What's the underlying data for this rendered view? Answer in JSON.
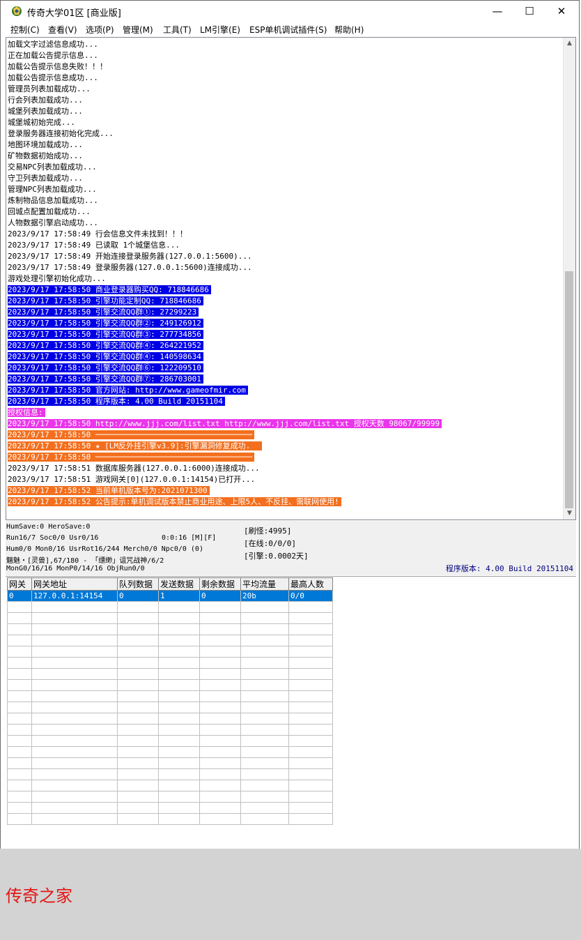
{
  "window": {
    "title": "传奇大学01区 [商业版]",
    "minimize": "—",
    "maximize": "☐",
    "close": "✕"
  },
  "menu": [
    "控制(C)",
    "查看(V)",
    "选项(P)",
    "管理(M)",
    "工具(T)",
    "LM引擎(E)",
    "ESP单机调试插件(S)",
    "帮助(H)"
  ],
  "log": [
    {
      "text": "加载文字过滤信息成功...",
      "style": ""
    },
    {
      "text": "正在加载公告提示信息...",
      "style": ""
    },
    {
      "text": "加载公告提示信息失败！！！",
      "style": ""
    },
    {
      "text": "加载公告提示信息成功...",
      "style": ""
    },
    {
      "text": "管理员列表加载成功...",
      "style": ""
    },
    {
      "text": "行会列表加载成功...",
      "style": ""
    },
    {
      "text": "城堡列表加载成功...",
      "style": ""
    },
    {
      "text": "城堡城初始完成...",
      "style": ""
    },
    {
      "text": "登录服务器连接初始化完成...",
      "style": ""
    },
    {
      "text": "地图环境加载成功...",
      "style": ""
    },
    {
      "text": "矿物数据初始成功...",
      "style": ""
    },
    {
      "text": "交易NPC列表加载成功...",
      "style": ""
    },
    {
      "text": "守卫列表加载成功...",
      "style": ""
    },
    {
      "text": "管理NPC列表加载成功...",
      "style": ""
    },
    {
      "text": "炼制物品信息加载成功...",
      "style": ""
    },
    {
      "text": "回城点配置加载成功...",
      "style": ""
    },
    {
      "text": "人物数据引擎启动成功...",
      "style": ""
    },
    {
      "text": "2023/9/17 17:58:49 行会信息文件未找到！！！",
      "style": ""
    },
    {
      "text": "2023/9/17 17:58:49 已读取 1个城堡信息...",
      "style": ""
    },
    {
      "text": "2023/9/17 17:58:49 开始连接登录服务器(127.0.0.1:5600)...",
      "style": ""
    },
    {
      "text": "2023/9/17 17:58:49 登录服务器(127.0.0.1:5600)连接成功...",
      "style": ""
    },
    {
      "text": "游戏处理引擎初始化成功...",
      "style": ""
    },
    {
      "text": "2023/9/17 17:58:50 商业登录器购买QQ: 718846686",
      "style": "hl-blue"
    },
    {
      "text": "2023/9/17 17:58:50 引擎功能定制QQ: 718846686",
      "style": "hl-blue"
    },
    {
      "text": "2023/9/17 17:58:50 引擎交流QQ群①: 27299223",
      "style": "hl-blue"
    },
    {
      "text": "2023/9/17 17:58:50 引擎交流QQ群②: 249126912",
      "style": "hl-blue"
    },
    {
      "text": "2023/9/17 17:58:50 引擎交流QQ群③: 277734856",
      "style": "hl-blue"
    },
    {
      "text": "2023/9/17 17:58:50 引擎交流QQ群④: 264221952",
      "style": "hl-blue"
    },
    {
      "text": "2023/9/17 17:58:50 引擎交流QQ群④: 140598634",
      "style": "hl-blue"
    },
    {
      "text": "2023/9/17 17:58:50 引擎交流QQ群⑥: 122209510",
      "style": "hl-blue"
    },
    {
      "text": "2023/9/17 17:58:50 引擎交流QQ群⑦: 286703001",
      "style": "hl-blue"
    },
    {
      "text": "2023/9/17 17:58:50 官方网站: http://www.gameofmir.com",
      "style": "hl-blue"
    },
    {
      "text": "2023/9/17 17:58:50 程序版本: 4.00 Build 20151104",
      "style": "hl-blue"
    },
    {
      "text": "授权信息:",
      "style": "hl-magenta"
    },
    {
      "text": "2023/9/17 17:58:50 http://www.jjj.com/list.txt http://www.jjj.com/list.txt 授权天数 98067/99999",
      "style": "hl-magenta"
    },
    {
      "text": "2023/9/17 17:58:50 ──────────────────────────────────",
      "style": "hl-orange"
    },
    {
      "text": "2023/9/17 17:58:50 ★ [LM反外挂引擎v3.9]:引擎漏洞修复成功.  ",
      "style": "hl-orange"
    },
    {
      "text": "2023/9/17 17:58:50 ──────────────────────────────────",
      "style": "hl-orange"
    },
    {
      "text": "2023/9/17 17:58:51 数据库服务器(127.0.0.1:6000)连接成功...",
      "style": ""
    },
    {
      "text": "2023/9/17 17:58:51 游戏网关[0](127.0.0.1:14154)已打开...",
      "style": ""
    },
    {
      "text": "2023/9/17 17:58:52 当前单机版本号为:2021071300",
      "style": "hl-orange"
    },
    {
      "text": "2023/9/17 17:58:52 公告提示:单机调试版本禁止商业用途、上限5人、不反挂、需联网使用!",
      "style": "hl-orange"
    }
  ],
  "status": {
    "line1": "HumSave:0 HeroSave:0",
    "line2": "Run16/7 Soc0/0 Usr0/16",
    "timer": "0:0:16 [M][F]",
    "line3": "Hum0/0 Mon0/16 UsrRot16/244 Merch0/0 Npc0/0 (0)",
    "line4": "魑魅・[灵兽],67/180 - 「缥缈」诅咒战神/6/2",
    "line5": "MonG0/16/16 MonP0/14/16 ObjRun0/0",
    "refresh": "[刷怪:4995]",
    "online": "[在线:0/0/0]",
    "engine": "[引擎:0.0002天]",
    "version": "程序版本: 4.00 Build 20151104"
  },
  "table": {
    "headers": [
      "网关",
      "网关地址",
      "队列数据",
      "发送数据",
      "剩余数据",
      "平均流量",
      "最高人数"
    ],
    "rows": [
      [
        "0",
        "127.0.0.1:14154",
        "0",
        "1",
        "0",
        "20b",
        "0/0"
      ]
    ],
    "empty_rows": 20
  },
  "watermark": "传奇之家"
}
